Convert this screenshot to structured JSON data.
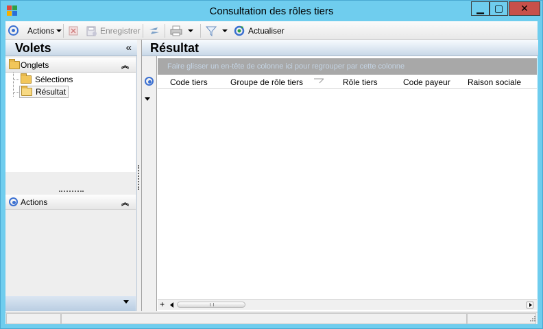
{
  "window": {
    "title": "Consultation des rôles tiers",
    "minimize_label": "▁",
    "maximize_label": "▢",
    "close_label": "✕"
  },
  "toolbar": {
    "actions_label": "Actions",
    "save_label": "Enregistrer",
    "refresh_label": "Actualiser",
    "icons": [
      "nav-ring-icon",
      "delete-icon",
      "save-icon",
      "sync-icon",
      "print-icon",
      "filter-icon",
      "refresh-icon"
    ]
  },
  "left_pane": {
    "title": "Volets",
    "collapse_glyph": "«",
    "tabs_section": {
      "label": "Onglets",
      "chevron": "︽",
      "items": [
        {
          "label": "Sélections",
          "selected": false
        },
        {
          "label": "Résultat",
          "selected": true
        }
      ]
    },
    "actions_section": {
      "label": "Actions",
      "chevron": "︽"
    }
  },
  "right_pane": {
    "title": "Résultat",
    "group_hint": "Faire glisser un en-tête de colonne ici pour regrouper par cette colonne",
    "columns": [
      "Code tiers",
      "Groupe de rôle tiers",
      "Rôle tiers",
      "Code payeur",
      "Raison sociale"
    ],
    "add_row_glyph": "+"
  },
  "colors": {
    "title_bar": "#6fcdee",
    "close_button": "#c7504a",
    "accent_ring": "#3a6fd1",
    "group_area": "#a8a8a8"
  }
}
